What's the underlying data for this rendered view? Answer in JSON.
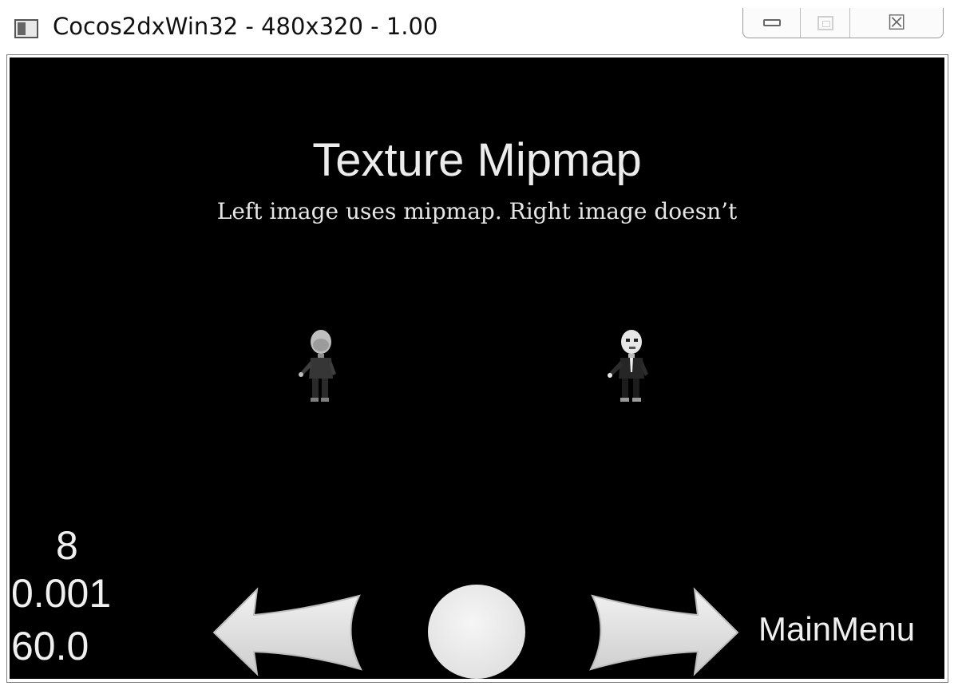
{
  "window": {
    "title": "Cocos2dxWin32 - 480x320 - 1.00",
    "icon": "app-window-icon",
    "controls": {
      "minimize_icon": "minimize-icon",
      "maximize_icon": "maximize-icon",
      "close_icon": "close-icon",
      "close_glyph": "☒"
    }
  },
  "scene": {
    "title": "Texture Mipmap",
    "subtitle": "Left image uses mipmap. Right image doesn’t",
    "sprites": [
      {
        "name": "grossini",
        "mipmap": true
      },
      {
        "name": "grossini",
        "mipmap": false
      }
    ]
  },
  "stats": {
    "draw_calls": "8",
    "frame_time": "0.001",
    "fps": "60.0"
  },
  "nav": {
    "back_icon": "back-arrow-icon",
    "restart_icon": "restart-circle-icon",
    "next_icon": "next-arrow-icon",
    "main_menu_label": "MainMenu"
  },
  "colors": {
    "viewport_background": "#000000",
    "text": "#ececec",
    "nav_buttons": "#e4e4e4"
  }
}
